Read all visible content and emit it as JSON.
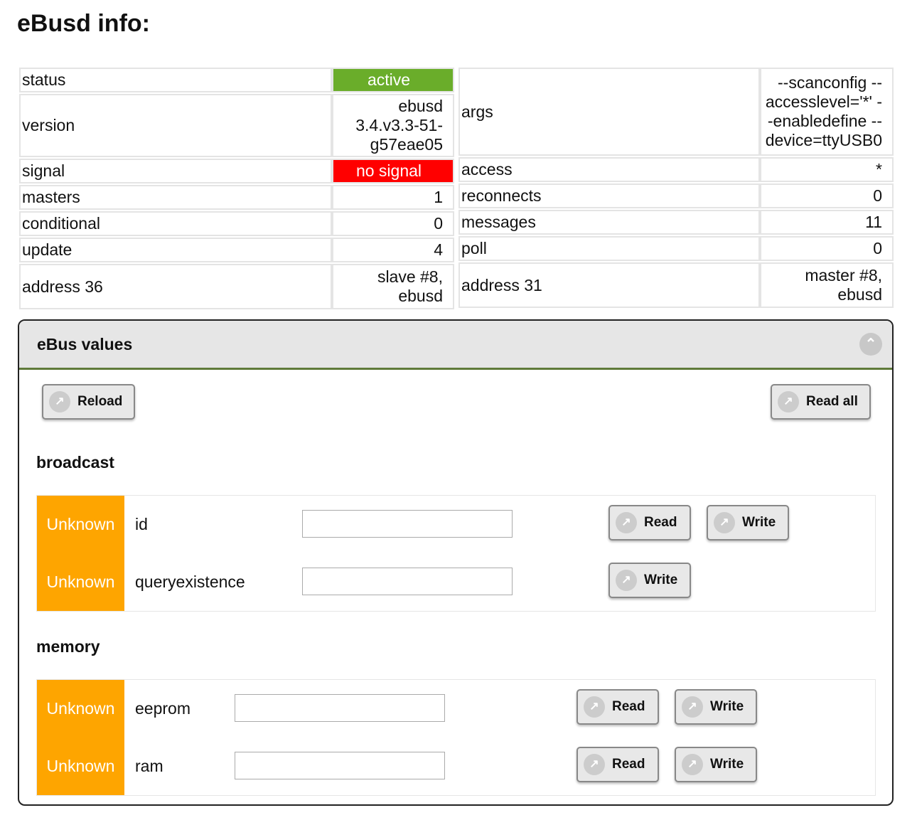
{
  "title": "eBusd info:",
  "left_table": [
    {
      "key": "status",
      "value": "active"
    },
    {
      "key": "version",
      "value": "ebusd 3.4.v3.3-51-g57eae05"
    },
    {
      "key": "signal",
      "value": "no signal"
    },
    {
      "key": "masters",
      "value": "1"
    },
    {
      "key": "conditional",
      "value": "0"
    },
    {
      "key": "update",
      "value": "4"
    },
    {
      "key": "address 36",
      "value": "slave #8, ebusd"
    }
  ],
  "right_table": [
    {
      "key": "args",
      "value": "--scanconfig --accesslevel='*' --enabledefine --device=ttyUSB0"
    },
    {
      "key": "access",
      "value": "*"
    },
    {
      "key": "reconnects",
      "value": "0"
    },
    {
      "key": "messages",
      "value": "11"
    },
    {
      "key": "poll",
      "value": "0"
    },
    {
      "key": "address 31",
      "value": "master #8, ebusd"
    }
  ],
  "colors": {
    "active": "#6aad2a",
    "no_signal": "#ff0000",
    "unknown": "#fea500"
  },
  "panel": {
    "title": "eBus values",
    "reload": "Reload",
    "read_all": "Read all"
  },
  "sections": [
    {
      "name": "broadcast",
      "rows": [
        {
          "badge": "Unknown",
          "name": "id",
          "value": "",
          "read": "Read",
          "write": "Write"
        },
        {
          "badge": "Unknown",
          "name": "queryexistence",
          "value": "",
          "write": "Write"
        }
      ]
    },
    {
      "name": "memory",
      "rows": [
        {
          "badge": "Unknown",
          "name": "eeprom",
          "value": "",
          "read": "Read",
          "write": "Write"
        },
        {
          "badge": "Unknown",
          "name": "ram",
          "value": "",
          "read": "Read",
          "write": "Write"
        }
      ]
    }
  ]
}
